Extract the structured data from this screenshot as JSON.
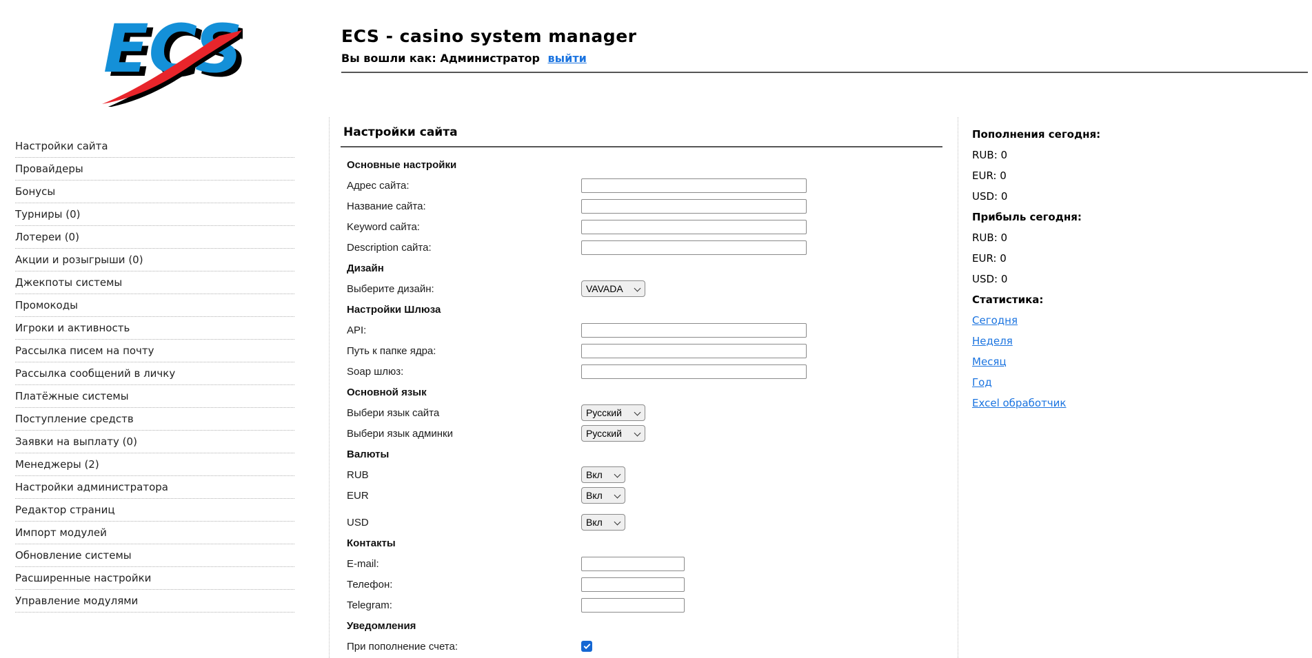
{
  "logo": {
    "text": "ECS",
    "blue": "#1490d8",
    "red": "#e8252b"
  },
  "header": {
    "title": "ECS - casino system manager",
    "login_prefix": "Вы вошли как:",
    "username": "Администратор",
    "logout_label": "выйти"
  },
  "sidebar": {
    "items": [
      "Настройки сайта",
      "Провайдеры",
      "Бонусы",
      "Турниры (0)",
      "Лотереи (0)",
      "Акции и розыгрыши (0)",
      "Джекпоты системы",
      "Промокоды",
      "Игроки и активность",
      "Рассылка писем на почту",
      "Рассылка сообщений в личку",
      "Платёжные системы",
      "Поступление средств",
      "Заявки на выплату (0)",
      "Менеджеры (2)",
      "Настройки администратора",
      "Редактор страниц",
      "Импорт модулей",
      "Обновление системы",
      "Расширенные настройки",
      "Управление модулями"
    ]
  },
  "form": {
    "title": "Настройки сайта",
    "rows": [
      {
        "type": "section",
        "label": "Основные настройки"
      },
      {
        "type": "input",
        "label": "Адрес сайта:",
        "value": ""
      },
      {
        "type": "input",
        "label": "Название сайта:",
        "value": ""
      },
      {
        "type": "input",
        "label": "Keyword сайта:",
        "value": ""
      },
      {
        "type": "input",
        "label": "Description сайта:",
        "value": ""
      },
      {
        "type": "section",
        "label": "Дизайн"
      },
      {
        "type": "select",
        "label": "Выберите дизайн:",
        "value": "VAVADA"
      },
      {
        "type": "section",
        "label": "Настройки Шлюза"
      },
      {
        "type": "input",
        "label": "API:",
        "value": ""
      },
      {
        "type": "input",
        "label": "Путь к папке ядра:",
        "value": ""
      },
      {
        "type": "input",
        "label": "Soap шлюз:",
        "value": ""
      },
      {
        "type": "section",
        "label": "Основной язык"
      },
      {
        "type": "select",
        "label": "Выбери язык сайта",
        "value": "Русский"
      },
      {
        "type": "select",
        "label": "Выбери язык админки",
        "value": "Русский"
      },
      {
        "type": "section",
        "label": "Валюты"
      },
      {
        "type": "select",
        "label": "RUB",
        "value": "Вкл"
      },
      {
        "type": "select",
        "label": "EUR",
        "value": "Вкл"
      },
      {
        "type": "select",
        "label": "USD",
        "value": "Вкл"
      },
      {
        "type": "section",
        "label": "Контакты"
      },
      {
        "type": "input",
        "label": "E-mail:",
        "value": ""
      },
      {
        "type": "input",
        "label": "Телефон:",
        "value": ""
      },
      {
        "type": "input",
        "label": "Telegram:",
        "value": ""
      },
      {
        "type": "section",
        "label": "Уведомления"
      },
      {
        "type": "checkbox",
        "label": "При пополнение счета:",
        "checked": true
      }
    ]
  },
  "stats": {
    "deposits_title": "Пополнения сегодня:",
    "deposits": [
      "RUB: 0",
      "EUR: 0",
      "USD: 0"
    ],
    "profit_title": "Прибыль сегодня:",
    "profit": [
      "RUB: 0",
      "EUR: 0",
      "USD: 0"
    ],
    "stats_title": "Статистика:",
    "links": [
      "Сегодня",
      "Неделя",
      "Месяц",
      "Год",
      "Excel обработчик"
    ]
  },
  "colors": {
    "link_blue": "#1b74e0",
    "checkbox_blue": "#1567d3",
    "rule_dark": "#555555"
  }
}
